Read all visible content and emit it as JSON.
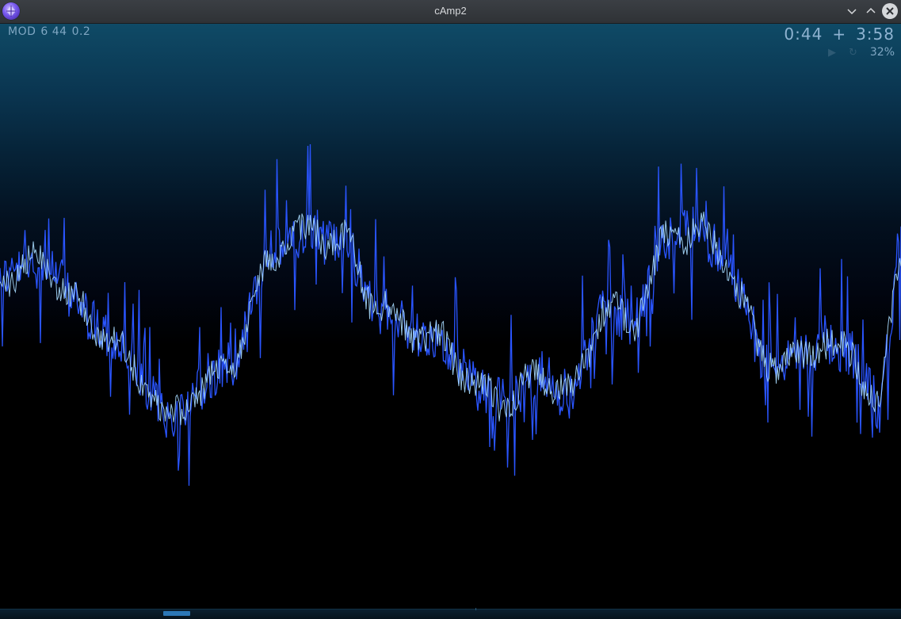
{
  "window": {
    "title": "cAmp2",
    "icon": "camp-logo-icon",
    "buttons": [
      "chevron-down-icon",
      "chevron-up-icon",
      "close-icon"
    ]
  },
  "track_info": {
    "format": "MOD",
    "channels": "6 44",
    "version": "0.2"
  },
  "playback": {
    "elapsed": "0:44",
    "separator": "+",
    "total": "3:58",
    "volume": "32%",
    "play_icon": "play-icon",
    "repeat_icon": "repeat-icon",
    "progress": 0.185
  },
  "colors": {
    "wave_blue": "#1f4fff",
    "wave_light": "#9fd4ff",
    "background_top": "#0f4a66",
    "background_bottom": "#000000"
  }
}
